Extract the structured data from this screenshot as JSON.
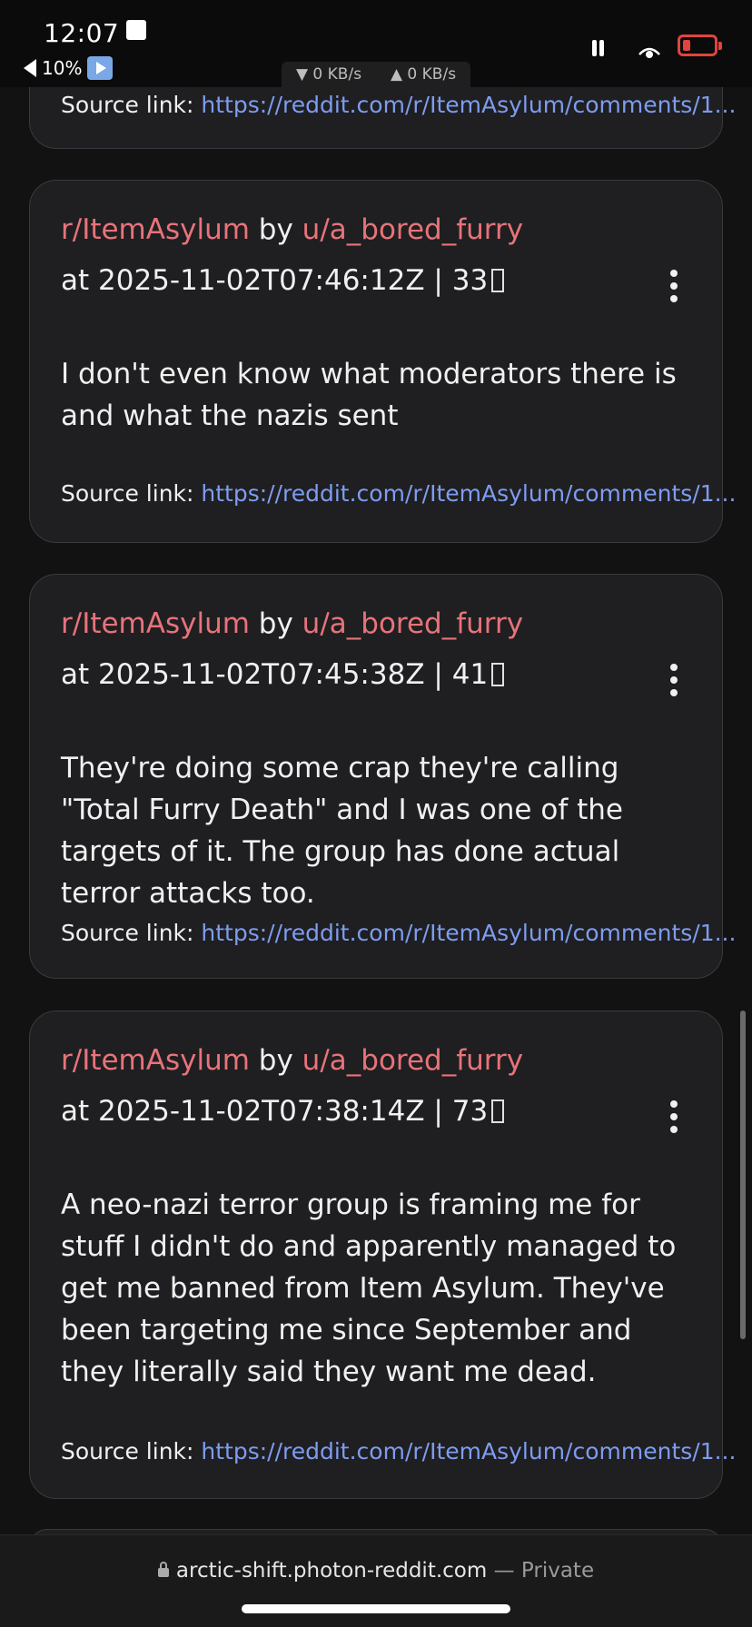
{
  "status_bar": {
    "time": "12:07",
    "battery_level_text": "10%",
    "download_speed": "▼ 0 KB/s",
    "upload_speed": "▲ 0 KB/s"
  },
  "posts": [
    {
      "source_label": "Source link:",
      "source_url": "https://reddit.com/r/ItemAsylum/comments/1..."
    },
    {
      "subreddit": "r/ItemAsylum",
      "by": "by",
      "user": "u/a_bored_furry",
      "timestamp": "at 2025-11-02T07:46:12Z | 33",
      "body": "I don't even know what moderators there is and what the nazis sent",
      "source_label": "Source link:",
      "source_url": "https://reddit.com/r/ItemAsylum/comments/1..."
    },
    {
      "subreddit": "r/ItemAsylum",
      "by": "by",
      "user": "u/a_bored_furry",
      "timestamp": "at 2025-11-02T07:45:38Z | 41",
      "body": "They're doing some crap they're calling \"Total Furry Death\" and I was one of the targets of it. The group has done actual terror attacks too.",
      "source_label": "Source link:",
      "source_url": "https://reddit.com/r/ItemAsylum/comments/1..."
    },
    {
      "subreddit": "r/ItemAsylum",
      "by": "by",
      "user": "u/a_bored_furry",
      "timestamp": "at 2025-11-02T07:38:14Z | 73",
      "body": "A neo-nazi terror group is framing me for stuff I didn't do and apparently managed to get me banned from Item Asylum. They've been targeting me since September and they literally said they want me dead.",
      "source_label": "Source link:",
      "source_url": "https://reddit.com/r/ItemAsylum/comments/1..."
    }
  ],
  "browser": {
    "domain": "arctic-shift.photon-reddit.com",
    "separator": "—",
    "mode": "Private"
  },
  "colors": {
    "link_red": "#e8737a",
    "link_blue": "#7e9cf0",
    "battery_red": "#e0443e"
  }
}
